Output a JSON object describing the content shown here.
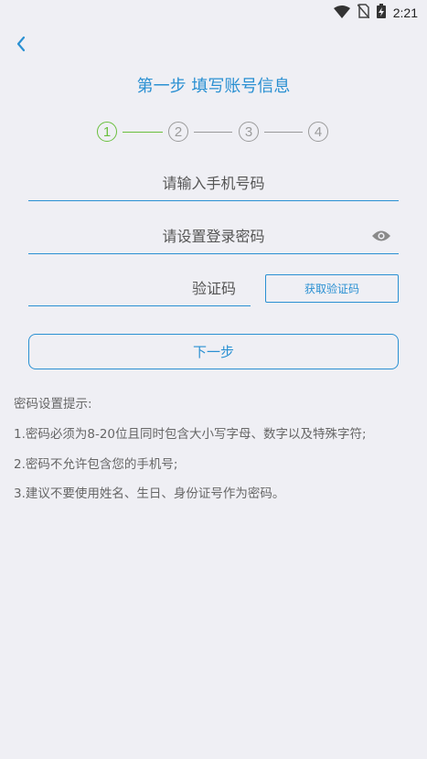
{
  "status_bar": {
    "time": "2:21",
    "icons": [
      "wifi-icon",
      "no-sim-icon",
      "battery-charging-icon"
    ]
  },
  "header": {
    "back_icon": "back-arrow-icon",
    "title": "第一步  填写账号信息"
  },
  "steps": {
    "items": [
      "1",
      "2",
      "3",
      "4"
    ],
    "active_index": 0,
    "active_color": "#6abf3e",
    "inactive_color": "#9a9a9a"
  },
  "form": {
    "phone_placeholder": "请输入手机号码",
    "password_placeholder": "请设置登录密码",
    "password_toggle_icon": "eye-icon",
    "code_placeholder": "验证码",
    "get_code_label": "获取验证码",
    "next_label": "下一步"
  },
  "tips": {
    "heading": "密码设置提示:",
    "lines": [
      "1.密码必须为8-20位且同时包含大小写字母、数字以及特殊字符;",
      "2.密码不允许包含您的手机号;",
      "3.建议不要使用姓名、生日、身份证号作为密码。"
    ]
  },
  "colors": {
    "accent": "#2a90d2",
    "background": "#efeff4"
  }
}
